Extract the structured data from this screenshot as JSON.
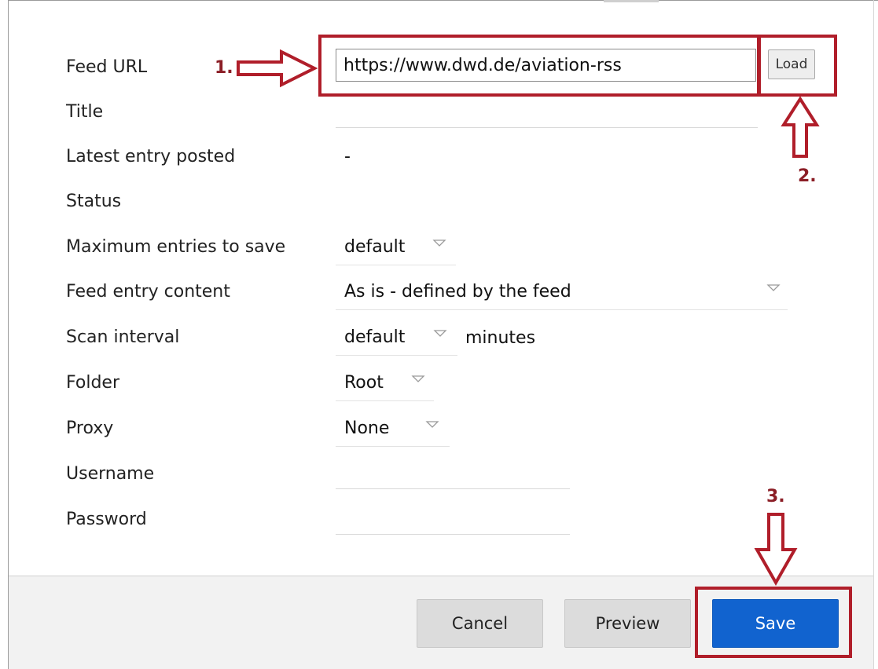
{
  "form": {
    "feed_url": {
      "label": "Feed URL",
      "value": "https://www.dwd.de/aviation-rss",
      "load_label": "Load"
    },
    "title": {
      "label": "Title",
      "value": ""
    },
    "latest_entry": {
      "label": "Latest entry posted",
      "value": "-"
    },
    "status": {
      "label": "Status",
      "value": ""
    },
    "max_entries": {
      "label": "Maximum entries to save",
      "selected": "default"
    },
    "feed_entry_content": {
      "label": "Feed entry content",
      "selected": "As is - defined by the feed"
    },
    "scan_interval": {
      "label": "Scan interval",
      "selected": "default",
      "unit": "minutes"
    },
    "folder": {
      "label": "Folder",
      "selected": "Root"
    },
    "proxy": {
      "label": "Proxy",
      "selected": "None"
    },
    "username": {
      "label": "Username",
      "value": ""
    },
    "password": {
      "label": "Password",
      "value": ""
    }
  },
  "footer": {
    "cancel_label": "Cancel",
    "preview_label": "Preview",
    "save_label": "Save"
  },
  "annotations": {
    "step1": "1.",
    "step2": "2.",
    "step3": "3.",
    "color": "#b01e2a"
  },
  "colors": {
    "primary_button": "#1163cf",
    "footer_bg": "#f2f2f2"
  },
  "icons": {
    "dropdown": "chevron-down-icon",
    "annotation_arrow": "hollow-arrow-icon"
  }
}
